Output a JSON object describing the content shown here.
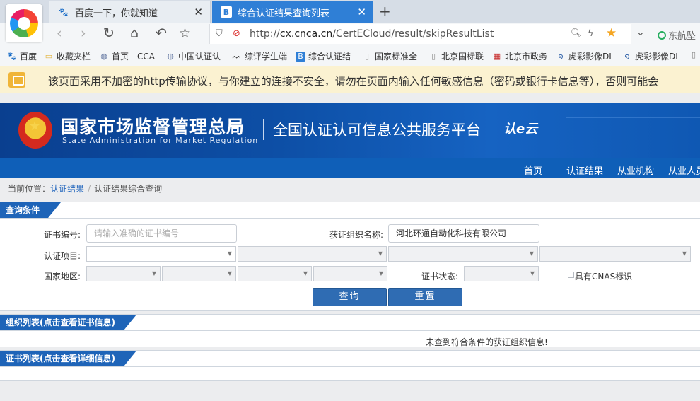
{
  "browser": {
    "tabs": [
      {
        "title": "百度一下，你就知道",
        "favicon": "baidu-paw-icon",
        "active": false
      },
      {
        "title": "综合认证结果查询列表",
        "favicon": "site-favicon",
        "active": true
      }
    ],
    "url_scheme": "http://",
    "url_domain": "cx.cnca.cn",
    "url_path": "/CertECloud/result/skipResultList",
    "right_search_label": "东航坠",
    "accent_color": "#2f7fd6"
  },
  "bookmarks": [
    {
      "label": "百度",
      "icon": "baidu-paw-icon"
    },
    {
      "label": "收藏夹栏",
      "icon": "folder-icon"
    },
    {
      "label": "首页 - CCA",
      "icon": "globe-icon"
    },
    {
      "label": "中国认证认",
      "icon": "globe-icon"
    },
    {
      "label": "综评学生端",
      "icon": "mountain-icon"
    },
    {
      "label": "综合认证结",
      "icon": "site-favicon"
    },
    {
      "label": "国家标准全",
      "icon": "page-icon"
    },
    {
      "label": "北京国标联",
      "icon": "page-icon"
    },
    {
      "label": "北京市政务",
      "icon": "grid-icon"
    },
    {
      "label": "虎彩影像DI",
      "icon": "swirl-icon"
    },
    {
      "label": "虎彩影像DI",
      "icon": "swirl-icon"
    },
    {
      "label": "",
      "icon": "page-icon"
    }
  ],
  "warning": {
    "text": "该页面采用不加密的http传输协议，与你建立的连接不安全，请勿在页面内输入任何敏感信息（密码或银行卡信息等），否则可能会"
  },
  "site": {
    "agency_cn": "国家市场监督管理总局",
    "agency_en": "State Administration  for  Market Regulation",
    "platform": "全国认证认可信息公共服务平台",
    "logo_text": "认e云"
  },
  "nav": [
    "首页",
    "认证结果",
    "从业机构",
    "从业人员"
  ],
  "breadcrumb": {
    "prefix": "当前位置：",
    "link": "认证结果",
    "sep": "/",
    "current": "认证结果综合查询"
  },
  "query": {
    "title": "查询条件",
    "cert_no_label": "证书编号:",
    "cert_no_placeholder": "请输入准确的证书编号",
    "org_label": "获证组织名称:",
    "org_value": "河北环通自动化科技有限公司",
    "project_label": "认证项目:",
    "region_label": "国家地区:",
    "status_label": "证书状态:",
    "cnas_label": "具有CNAS标识",
    "search_button": "查询",
    "reset_button": "重置"
  },
  "org_list": {
    "title": "组织列表(点击查看证书信息)",
    "empty_message": "未查到符合条件的获证组织信息!"
  },
  "cert_list": {
    "title": "证书列表(点击查看详细信息)"
  }
}
